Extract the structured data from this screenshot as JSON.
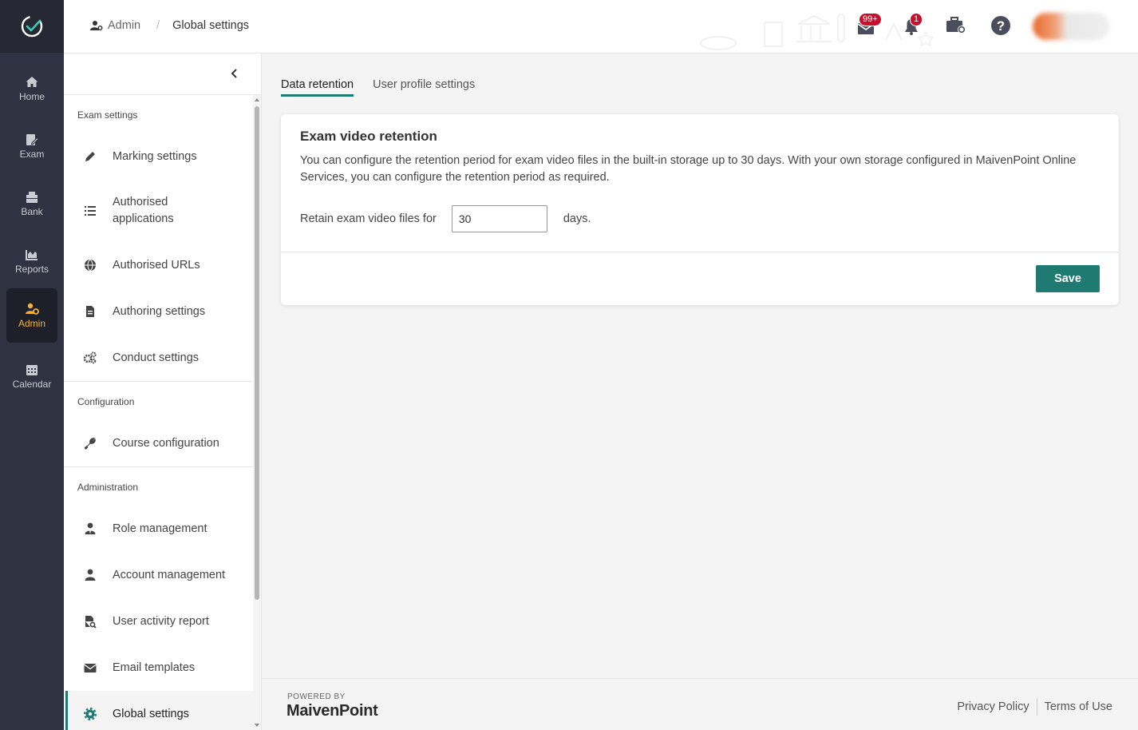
{
  "rail": {
    "items": [
      {
        "label": "Home",
        "icon": "home-icon"
      },
      {
        "label": "Exam",
        "icon": "exam-icon"
      },
      {
        "label": "Bank",
        "icon": "bank-icon"
      },
      {
        "label": "Reports",
        "icon": "reports-icon"
      },
      {
        "label": "Admin",
        "icon": "admin-icon",
        "active": true
      },
      {
        "label": "Calendar",
        "icon": "calendar-icon"
      }
    ],
    "active_color": "#f0b23a"
  },
  "breadcrumb": {
    "parent": "Admin",
    "current": "Global settings",
    "separator": "/"
  },
  "header": {
    "messages_badge": "99+",
    "notifications_badge": "1"
  },
  "sidebar": {
    "groups": [
      {
        "title": "Exam settings",
        "items": [
          {
            "label": "Marking settings",
            "icon": "pencil-icon"
          },
          {
            "label": "Authorised applications",
            "icon": "list-icon"
          },
          {
            "label": "Authorised URLs",
            "icon": "globe-icon"
          },
          {
            "label": "Authoring settings",
            "icon": "document-icon"
          },
          {
            "label": "Conduct settings",
            "icon": "cogs-icon"
          }
        ]
      },
      {
        "title": "Configuration",
        "items": [
          {
            "label": "Course configuration",
            "icon": "wrench-icon"
          }
        ]
      },
      {
        "title": "Administration",
        "items": [
          {
            "label": "Role management",
            "icon": "user-tie-icon"
          },
          {
            "label": "Account management",
            "icon": "user-icon"
          },
          {
            "label": "User activity report",
            "icon": "file-search-icon"
          },
          {
            "label": "Email templates",
            "icon": "envelope-icon"
          },
          {
            "label": "Global settings",
            "icon": "gear-icon",
            "active": true
          }
        ]
      }
    ]
  },
  "tabs": [
    {
      "label": "Data retention",
      "active": true
    },
    {
      "label": "User profile settings",
      "active": false
    }
  ],
  "card": {
    "title": "Exam video retention",
    "description": "You can configure the retention period for exam video files in the built-in storage up to 30 days. With your own storage configured in MaivenPoint Online Services, you can configure the retention period as required.",
    "retain_label": "Retain exam video files for",
    "retain_value": "30",
    "retain_suffix": "days.",
    "save_label": "Save"
  },
  "footer": {
    "powered_by": "POWERED BY",
    "brand": "MaivenPoint",
    "privacy": "Privacy Policy",
    "terms": "Terms of Use"
  },
  "colors": {
    "accent": "#1f7a72",
    "rail_bg": "#2f3240",
    "badge": "#c8102e"
  }
}
